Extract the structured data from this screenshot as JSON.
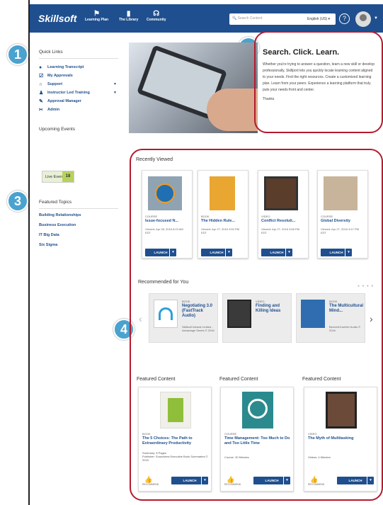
{
  "header": {
    "logo": "Skillsoft",
    "nav": [
      {
        "label": "Learning Plan",
        "icon": "learning-plan-icon"
      },
      {
        "label": "The Library",
        "icon": "library-icon"
      },
      {
        "label": "Community",
        "icon": "community-icon"
      }
    ],
    "search_placeholder": "Search Content",
    "language": "English (US)"
  },
  "sidebar": {
    "quick_links_title": "Quick Links",
    "quick_links": [
      {
        "label": "Learning Transcript",
        "icon": "transcript-icon"
      },
      {
        "label": "My Approvals",
        "icon": "checkbox-icon"
      },
      {
        "label": "Support",
        "icon": "headset-icon",
        "expand": "▼"
      },
      {
        "label": "Instructor Led Training",
        "icon": "instructor-icon",
        "expand": "▼"
      },
      {
        "label": "Approval Manager",
        "icon": "approval-icon"
      },
      {
        "label": "Admin",
        "icon": "wrench-icon"
      }
    ],
    "events_title": "Upcoming Events",
    "live_events_label": "Live Events",
    "live_events_count": "18",
    "topics_title": "Featured Topics",
    "topics": [
      "Building Relationships",
      "Business Execution",
      "IT Big Data",
      "Six Sigma"
    ]
  },
  "callouts": [
    "1",
    "2",
    "3",
    "4"
  ],
  "welcome": {
    "title": "Search. Click. Learn.",
    "body": "Whether you're trying to answer a question, learn a new skill or develop professionally, Skillport lets you quickly locate learning content aligned to your needs. Find the right resources. Create a customized learning plan. Learn from your peers. Experience a learning platform that truly puts your needs front and center.",
    "thanks": "Thanks"
  },
  "recently_viewed": {
    "title": "Recently Viewed",
    "launch_label": "LAUNCH",
    "items": [
      {
        "type": "COURSE",
        "title": "Issue-focused N...",
        "meta": "Viewed: Apr 28, 2016 8:23 AM EDT"
      },
      {
        "type": "BOOK",
        "title": "The Hidden Rule...",
        "meta": "Viewed: Apr 27, 2016 3:52 PM EDT"
      },
      {
        "type": "VIDEO",
        "title": "Conflict Resoluti...",
        "meta": "Viewed: Apr 27, 2016 3:56 PM EDT"
      },
      {
        "type": "COURSE",
        "title": "Global Diversity",
        "meta": "Viewed: Apr 27, 2016 3:47 PM EDT"
      }
    ]
  },
  "recommended": {
    "title": "Recommended for You",
    "items": [
      {
        "type": "BOOK",
        "title": "Negotiating 3.0 (FastTrack Audio)",
        "meta": "Skillsoft Ireland Limited - Advantage Series © 2016"
      },
      {
        "type": "VIDEO",
        "title": "Finding and Killing Ideas",
        "meta": ""
      },
      {
        "type": "BOOK",
        "title": "The Multicultural Mind...",
        "meta": "Bennett-Koehler Audio © 2016"
      }
    ]
  },
  "featured": {
    "title": "Featured Content",
    "launch_label": "LAUNCH",
    "recommend_label": "RECOMMEND",
    "items": [
      {
        "type": "BOOK",
        "title": "The 5 Choices: The Path to Extraordinary Productivity",
        "meta": "Summary: 8 Pages\nPublisher: Soundview Executive Book Summaries © 2015"
      },
      {
        "type": "COURSE",
        "title": "Time Management: Too Much to Do and Too Little Time",
        "meta": "Course: 30 Minutes"
      },
      {
        "type": "VIDEO",
        "title": "The Myth of Multitasking",
        "meta": "Videos: 4 Minutes"
      }
    ]
  }
}
